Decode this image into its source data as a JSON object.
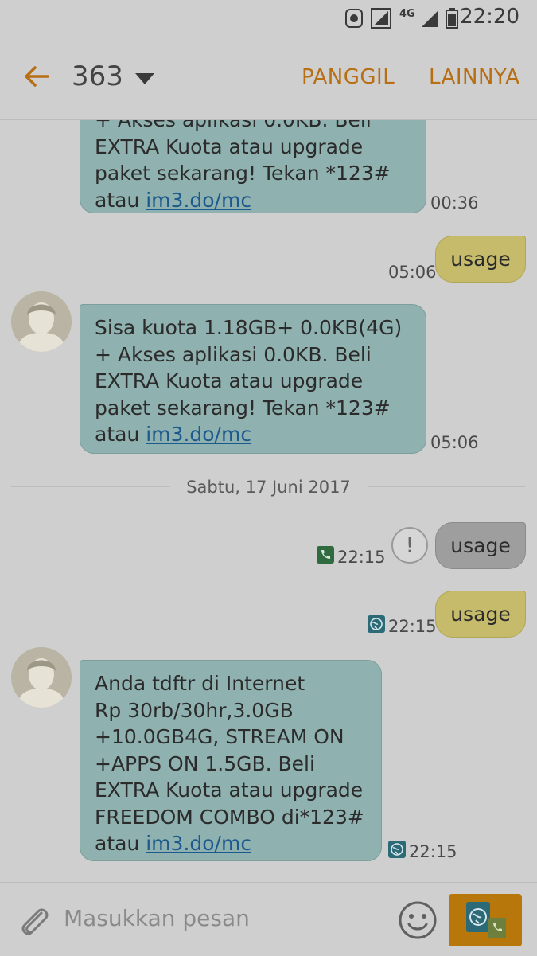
{
  "status": {
    "time": "22:20",
    "network": "4G"
  },
  "header": {
    "title": "363",
    "call_label": "PANGGIL",
    "more_label": "LAINNYA"
  },
  "messages": {
    "m1": {
      "partial": "+ Akses aplikasi 0.0KB. Beli",
      "l1": "EXTRA Kuota atau upgrade",
      "l2": "paket sekarang! Tekan *123#",
      "l3a": "atau ",
      "link": "im3.do/mc",
      "time": "00:36"
    },
    "m2": {
      "text": "usage",
      "time": "05:06"
    },
    "m3": {
      "l1": "Sisa kuota 1.18GB+ 0.0KB(4G)",
      "l2": "+ Akses aplikasi 0.0KB. Beli",
      "l3": "EXTRA Kuota atau upgrade",
      "l4": "paket sekarang! Tekan *123#",
      "l5a": "atau ",
      "link": "im3.do/mc",
      "time": "05:06"
    },
    "date_divider": "Sabtu, 17 Juni 2017",
    "m4": {
      "text": "usage",
      "time": "22:15",
      "warn": "!"
    },
    "m5": {
      "text": "usage",
      "time": "22:15"
    },
    "m6": {
      "l1": "Anda tdftr di Internet",
      "l2": "Rp 30rb/30hr,3.0GB",
      "l3": "+10.0GB4G, STREAM ON",
      "l4": "+APPS ON 1.5GB. Beli",
      "l5": "EXTRA Kuota atau upgrade",
      "l6": "FREEDOM COMBO di*123#",
      "l7a": "atau ",
      "link": "im3.do/mc",
      "time": "22:15"
    }
  },
  "input": {
    "placeholder": "Masukkan pesan"
  },
  "colors": {
    "accent": "#b86f13",
    "incoming": "#8fb1af",
    "outgoing": "#c6bb6b",
    "failed": "#9e9e9e"
  }
}
